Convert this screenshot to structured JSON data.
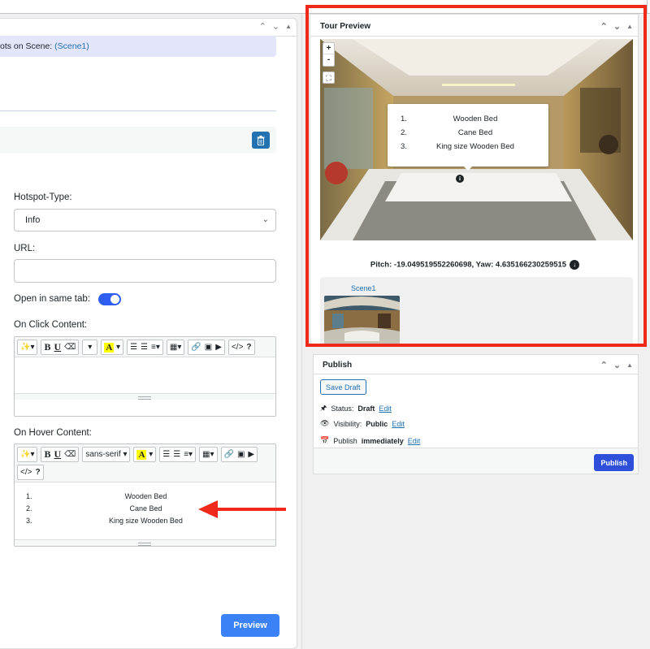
{
  "left": {
    "hotspots_prefix": "ots on Scene: ",
    "hotspots_scene": "(Scene1)",
    "hotspot_type_label": "Hotspot-Type:",
    "hotspot_type_value": "Info",
    "url_label": "URL:",
    "url_value": "",
    "open_same_tab_label": "Open in same tab:",
    "open_same_tab_on": true,
    "on_click_label": "On Click Content:",
    "on_hover_label": "On Hover Content:",
    "font_select": "sans-serif",
    "hover_list": [
      {
        "n": "1.",
        "t": "Wooden Bed"
      },
      {
        "n": "2.",
        "t": "Cane Bed"
      },
      {
        "n": "3.",
        "t": "King size Wooden Bed"
      }
    ],
    "preview_label": "Preview"
  },
  "tour": {
    "title": "Tour Preview",
    "zoom_in": "+",
    "zoom_out": "-",
    "popup_list": [
      {
        "n": "1.",
        "t": "Wooden Bed"
      },
      {
        "n": "2.",
        "t": "Cane Bed"
      },
      {
        "n": "3.",
        "t": "King size Wooden Bed"
      }
    ],
    "pitch_text": "Pitch: -19.049519552260698, Yaw: 4.635166230259515",
    "scene_name": "Scene1"
  },
  "publish": {
    "title": "Publish",
    "save_draft": "Save Draft",
    "status_label": "Status:",
    "status_value": "Draft",
    "visibility_label": "Visibility:",
    "visibility_value": "Public",
    "publish_label": "Publish",
    "publish_value": "immediately",
    "edit": "Edit",
    "publish_button": "Publish"
  },
  "colors": {
    "accent": "#2271b1",
    "highlight_frame": "#f0291a",
    "primary_button": "#3b82f6",
    "toggle_on": "#2e5ff2"
  }
}
